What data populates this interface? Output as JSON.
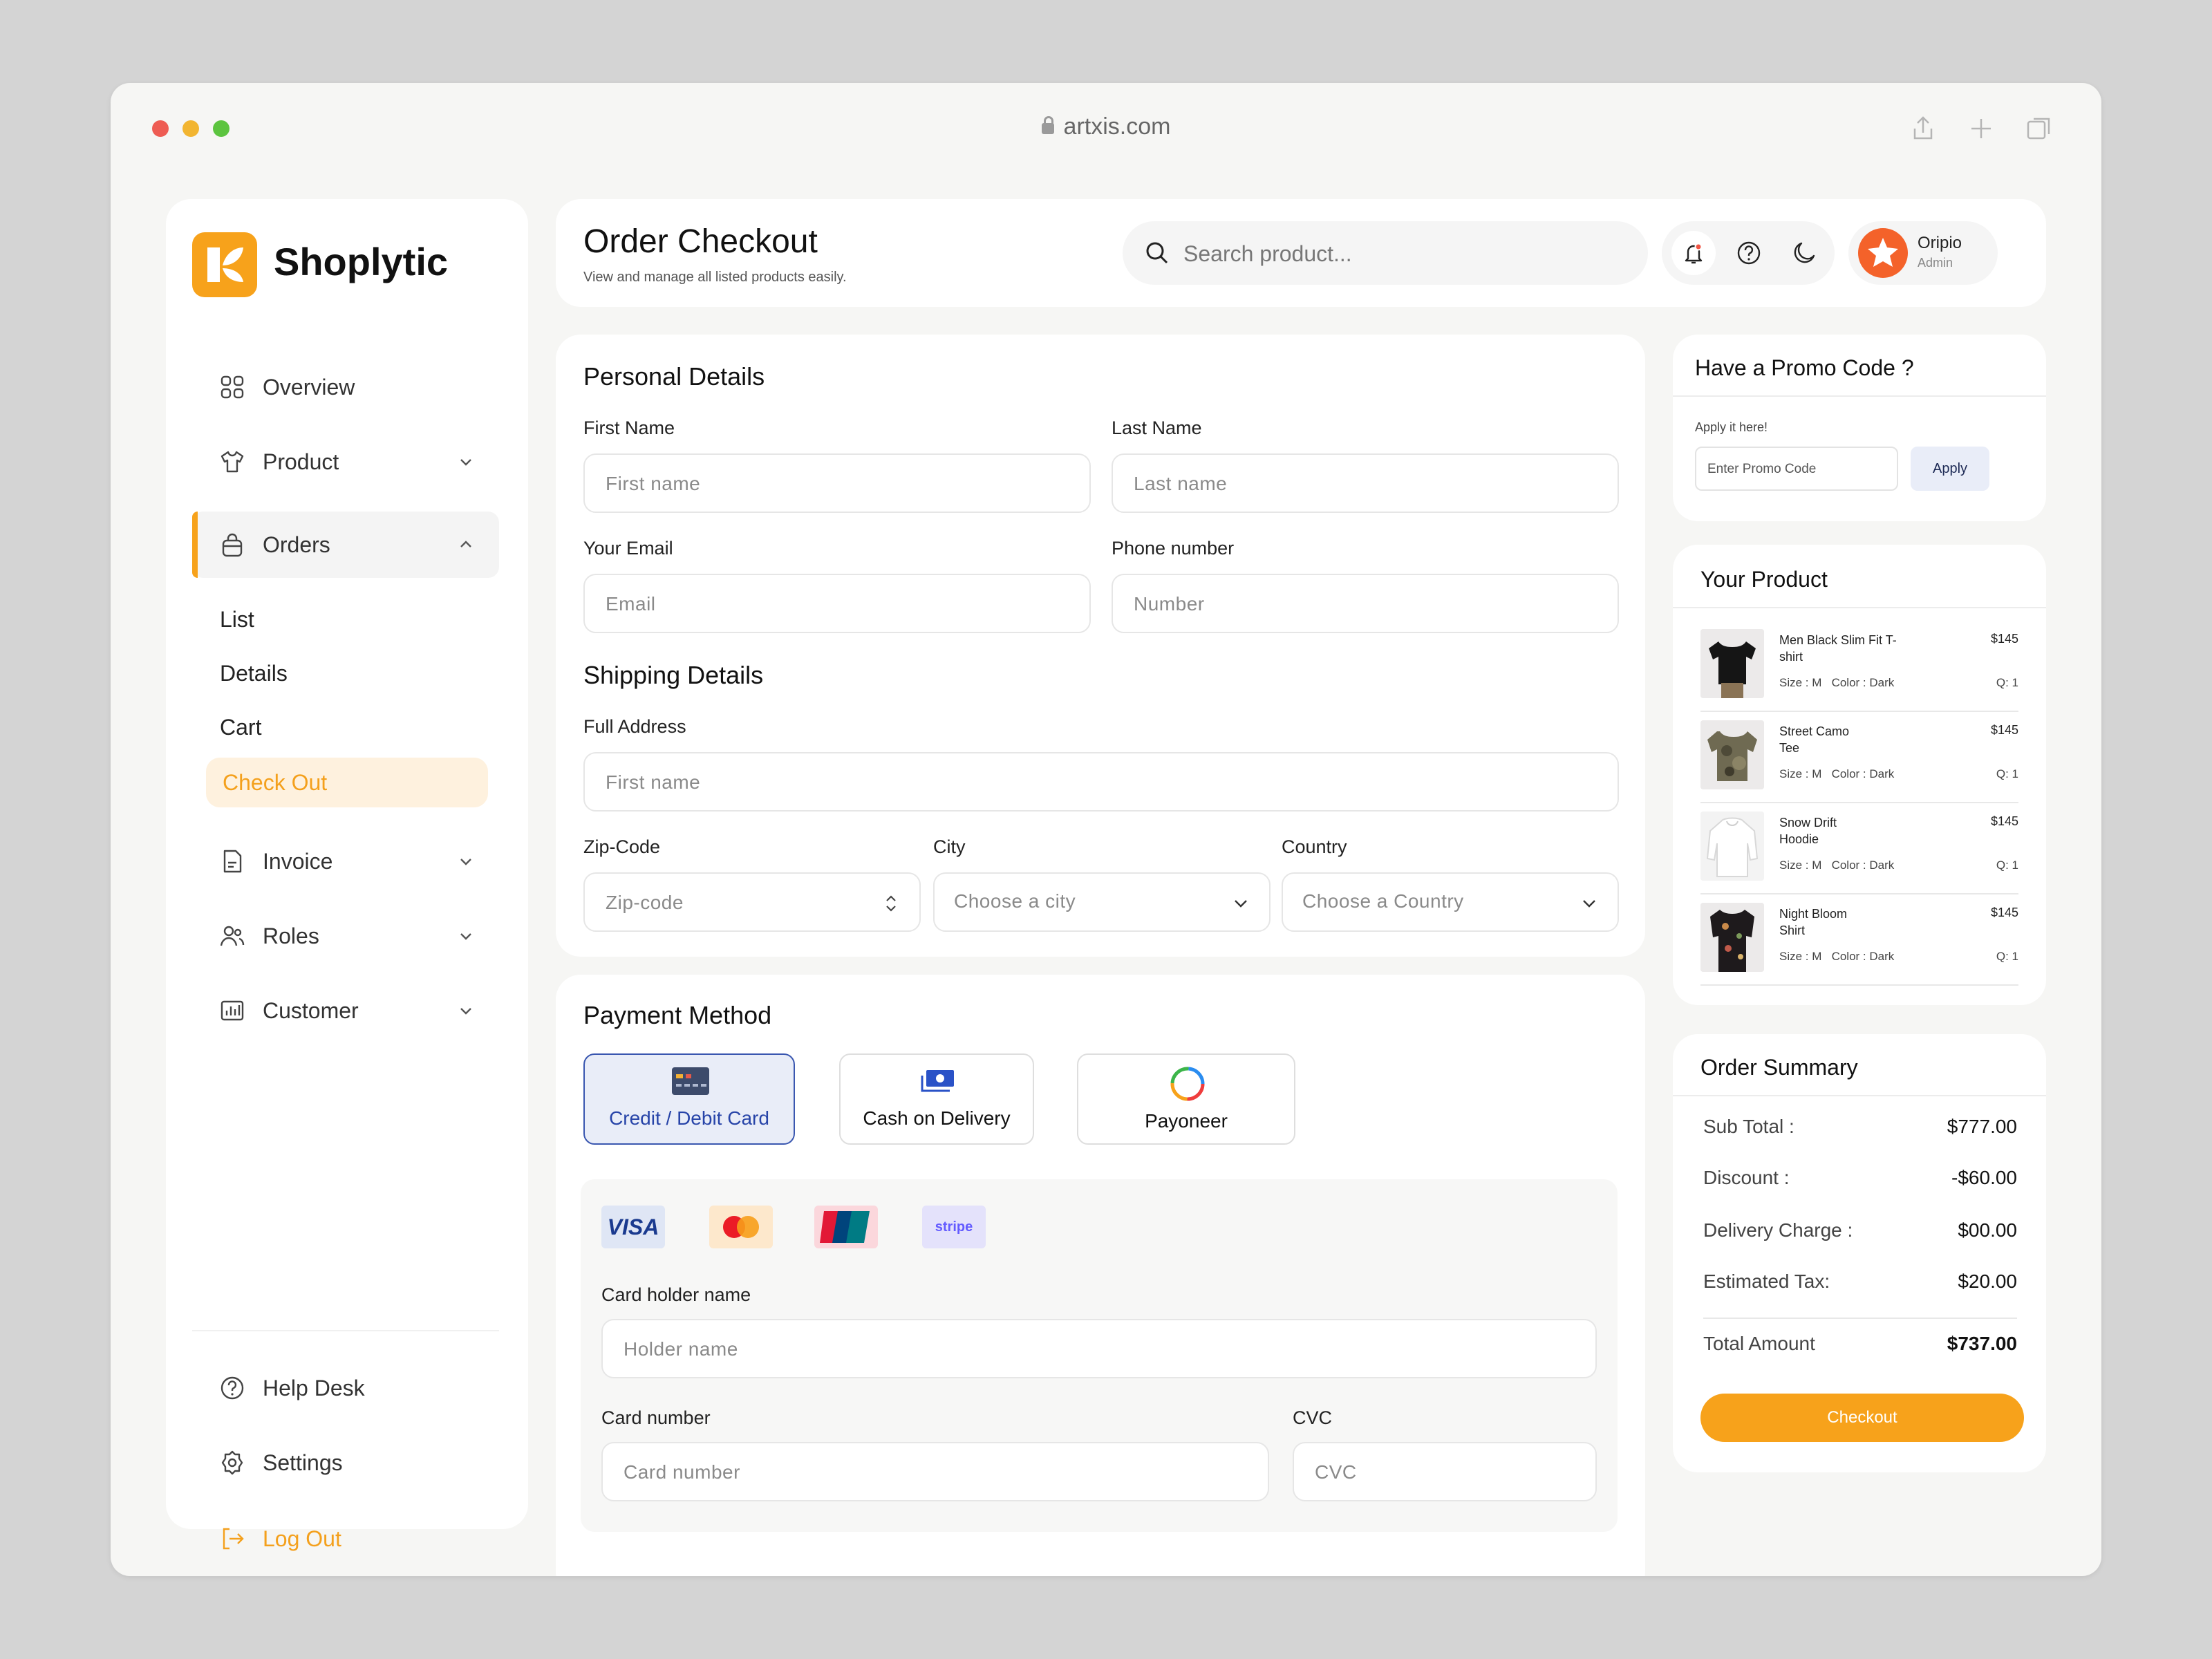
{
  "browser": {
    "url": "artxis.com"
  },
  "colors": {
    "accent": "#f7a21b",
    "selected_blue": "#2744a8",
    "window_bg": "#f6f6f4"
  },
  "sidebar": {
    "brand": "Shoplytic",
    "items": [
      {
        "label": "Overview",
        "icon": "grid-icon"
      },
      {
        "label": "Product",
        "icon": "shirt-icon"
      },
      {
        "label": "Orders",
        "icon": "bag-icon"
      },
      {
        "label": "Invoice",
        "icon": "document-icon"
      },
      {
        "label": "Roles",
        "icon": "users-icon"
      },
      {
        "label": "Customer",
        "icon": "customer-icon"
      }
    ],
    "orders_sub": [
      "List",
      "Details",
      "Cart",
      "Check Out"
    ],
    "bottom": [
      {
        "label": "Help Desk",
        "icon": "help-icon"
      },
      {
        "label": "Settings",
        "icon": "gear-icon"
      },
      {
        "label": "Log Out",
        "icon": "logout-icon"
      }
    ]
  },
  "header": {
    "title": "Order Checkout",
    "subtitle": "View and manage all listed products easily.",
    "search_placeholder": "Search product...",
    "user_name": "Oripio",
    "user_role": "Admin"
  },
  "personal": {
    "title": "Personal Details",
    "first_name_label": "First Name",
    "first_name_placeholder": "First name",
    "last_name_label": "Last Name",
    "last_name_placeholder": "Last name",
    "email_label": "Your Email",
    "email_placeholder": "Email",
    "phone_label": "Phone number",
    "phone_placeholder": "Number"
  },
  "shipping": {
    "title": "Shipping Details",
    "address_label": "Full Address",
    "address_placeholder": "First name",
    "zip_label": "Zip-Code",
    "zip_placeholder": "Zip-code",
    "city_label": "City",
    "city_value": "Choose a city",
    "country_label": "Country",
    "country_value": "Choose a Country"
  },
  "payment": {
    "title": "Payment Method",
    "options": [
      "Credit / Debit Card",
      "Cash on Delivery",
      "Payoneer"
    ],
    "brands": [
      "VISA",
      "stripe"
    ],
    "holder_label": "Card holder name",
    "holder_placeholder": "Holder name",
    "card_label": "Card number",
    "card_placeholder": "Card number",
    "cvc_label": "CVC",
    "cvc_placeholder": "CVC"
  },
  "promo": {
    "title": "Have a Promo Code ?",
    "hint": "Apply it here!",
    "placeholder": "Enter Promo Code",
    "button": "Apply"
  },
  "your_product": {
    "title": "Your Product",
    "items": [
      {
        "name": "Men Black Slim Fit T-shirt",
        "price": "$145",
        "size": "Size : M",
        "color": "Color : Dark",
        "qty": "Q: 1"
      },
      {
        "name": "Street Camo Tee",
        "price": "$145",
        "size": "Size : M",
        "color": "Color : Dark",
        "qty": "Q: 1"
      },
      {
        "name": "Snow Drift Hoodie",
        "price": "$145",
        "size": "Size : M",
        "color": "Color : Dark",
        "qty": "Q: 1"
      },
      {
        "name": "Night Bloom Shirt",
        "price": "$145",
        "size": "Size : M",
        "color": "Color : Dark",
        "qty": "Q: 1"
      }
    ]
  },
  "summary": {
    "title": "Order Summary",
    "rows": [
      {
        "label": "Sub Total :",
        "value": "$777.00"
      },
      {
        "label": "Discount :",
        "value": "-$60.00"
      },
      {
        "label": "Delivery Charge :",
        "value": "$00.00"
      },
      {
        "label": "Estimated Tax:",
        "value": "$20.00"
      }
    ],
    "total_label": "Total Amount",
    "total_value": "$737.00",
    "checkout": "Checkout"
  }
}
